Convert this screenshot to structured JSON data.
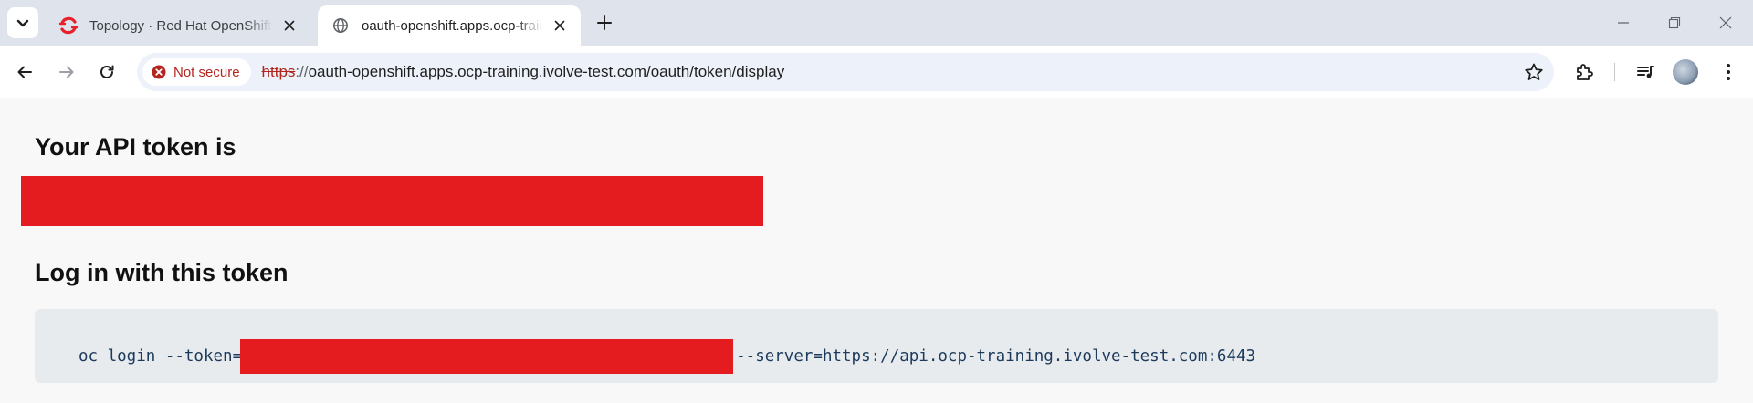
{
  "browser": {
    "tabs": [
      {
        "title": "Topology · Red Hat OpenShift C",
        "icon": "openshift-icon",
        "active": false
      },
      {
        "title": "oauth-openshift.apps.ocp-trainin",
        "icon": "globe-icon",
        "active": true
      }
    ],
    "omnibox": {
      "security_label": "Not secure",
      "url_scheme": "https",
      "url_sep": "://",
      "url_rest": "oauth-openshift.apps.ocp-training.ivolve-test.com/oauth/token/display"
    }
  },
  "page": {
    "heading_token": "Your API token is",
    "heading_login": "Log in with this token",
    "login_command_prefix": "oc login --token=",
    "login_command_suffix": "--server=https://api.ocp-training.ivolve-test.com:6443"
  },
  "colors": {
    "redaction": "#e51c1f",
    "not_secure": "#b3261e",
    "openshift_red": "#e8202a"
  }
}
